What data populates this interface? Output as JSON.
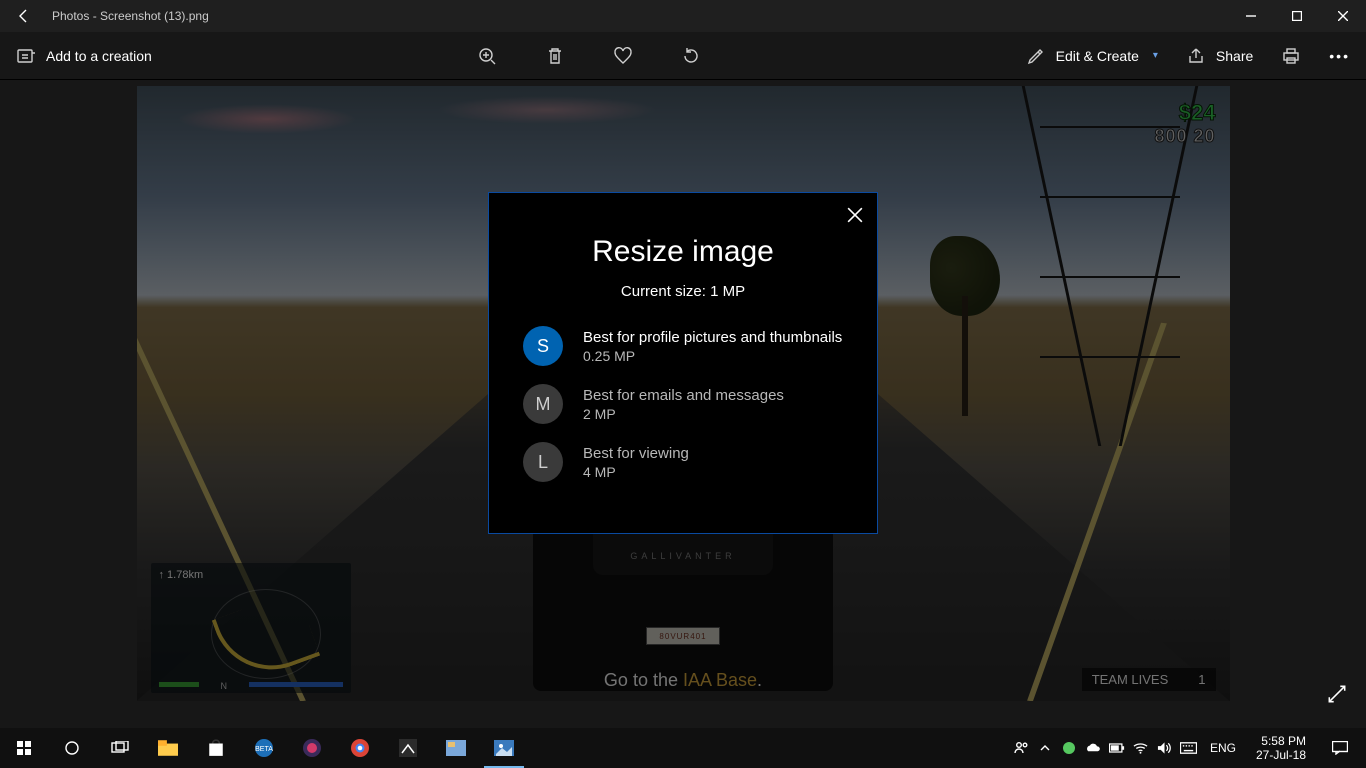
{
  "titlebar": {
    "app": "Photos",
    "filename": "Screenshot (13).png"
  },
  "commandbar": {
    "add_to_creation": "Add to a creation",
    "edit_create": "Edit & Create",
    "share": "Share"
  },
  "dialog": {
    "title": "Resize image",
    "current_size_label": "Current size: 1 MP",
    "options": [
      {
        "badge": "S",
        "line1": "Best for profile pictures and thumbnails",
        "line2": "0.25 MP",
        "selected": true
      },
      {
        "badge": "M",
        "line1": "Best for emails and messages",
        "line2": "2 MP",
        "selected": false
      },
      {
        "badge": "L",
        "line1": "Best for viewing",
        "line2": "4 MP",
        "selected": false
      }
    ]
  },
  "photo_overlay": {
    "hud_cash": "$24",
    "hud_bank": "800 20",
    "mission_prefix": "Go to the ",
    "mission_highlight": "IAA Base",
    "mission_suffix": ".",
    "team_lives_label": "TEAM LIVES",
    "team_lives_value": "1",
    "minimap_distance": "↑ 1.78km",
    "minimap_n": "N",
    "car_badge": "GALLIVANTER",
    "plate": "80VUR401"
  },
  "taskbar": {
    "lang": "ENG",
    "time": "5:58 PM",
    "date": "27-Jul-18"
  }
}
